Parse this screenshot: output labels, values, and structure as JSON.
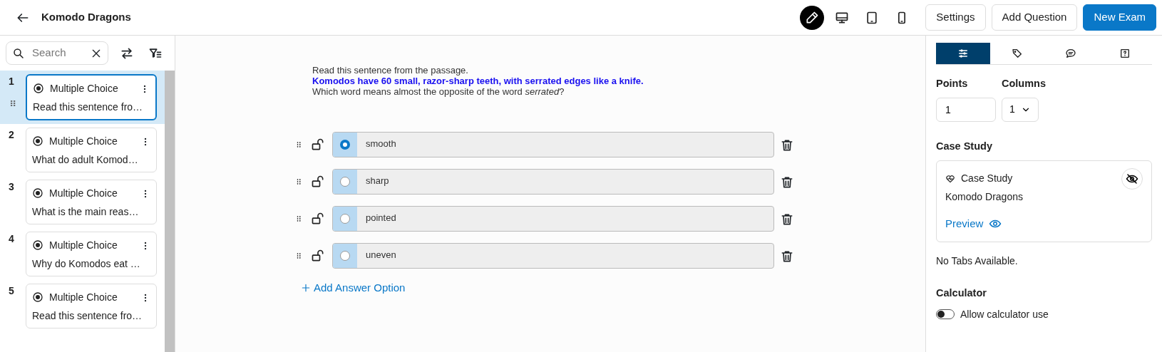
{
  "header": {
    "title": "Komodo Dragons"
  },
  "view_modes": [
    {
      "kind": "edit",
      "selected": true
    },
    {
      "kind": "desktop",
      "selected": false
    },
    {
      "kind": "tablet",
      "selected": false
    },
    {
      "kind": "mobile",
      "selected": false
    }
  ],
  "header_buttons": [
    {
      "label": "Settings",
      "kind": "outline"
    },
    {
      "label": "Add Question",
      "kind": "outline"
    },
    {
      "label": "New Exam",
      "kind": "primary"
    }
  ],
  "sidebar": {
    "search": {
      "placeholder": "Search"
    },
    "items": [
      {
        "number": "1",
        "type": "Multiple Choice",
        "preview": "Read this sentence fro…",
        "selected": true
      },
      {
        "number": "2",
        "type": "Multiple Choice",
        "preview": "What do adult Komod…",
        "selected": false
      },
      {
        "number": "3",
        "type": "Multiple Choice",
        "preview": "What is the main reas…",
        "selected": false
      },
      {
        "number": "4",
        "type": "Multiple Choice",
        "preview": "Why do Komodos eat …",
        "selected": false
      },
      {
        "number": "5",
        "type": "Multiple Choice",
        "preview": "Read this sentence fro…",
        "selected": false
      }
    ]
  },
  "question": {
    "prompt": "Read this sentence from the passage.",
    "quote": "Komodos have 60 small, razor-sharp teeth, with serrated edges like a knife.",
    "ask": "Which word means almost the opposite of the word *serrated*?",
    "options": [
      {
        "text": "smooth",
        "selected": true
      },
      {
        "text": "sharp",
        "selected": false
      },
      {
        "text": "pointed",
        "selected": false
      },
      {
        "text": "uneven",
        "selected": false
      }
    ],
    "add_option": "Add Answer Option"
  },
  "panel": {
    "tabs": [
      {
        "kind": "settings",
        "selected": true
      },
      {
        "kind": "tags",
        "selected": false
      },
      {
        "kind": "comments",
        "selected": false
      },
      {
        "kind": "help",
        "selected": false
      }
    ],
    "points_label": "Points",
    "points": "1",
    "columns_label": "Columns",
    "columns": "1",
    "case_study_heading": "Case Study",
    "case_study": {
      "label": "Case Study",
      "name": "Komodo Dragons",
      "preview": "Preview"
    },
    "no_tabs": "No Tabs Available.",
    "calculator_heading": "Calculator",
    "calculator": {
      "label": "Allow calculator use",
      "on": false
    }
  }
}
